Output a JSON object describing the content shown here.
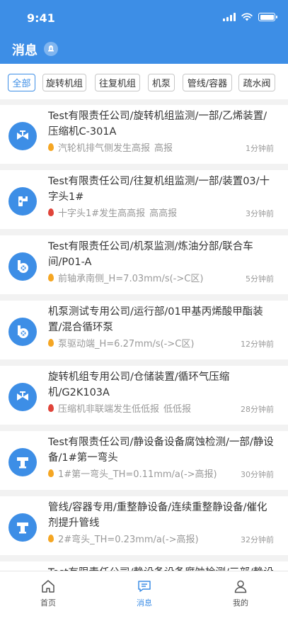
{
  "status": {
    "time": "9:41"
  },
  "header": {
    "title": "消息"
  },
  "filters": [
    "全部",
    "旋转机组",
    "往复机组",
    "机泵",
    "管线/容器",
    "疏水阀"
  ],
  "messages": [
    {
      "icon": "valve-icon",
      "title": "Test有限责任公司/旋转机组监测/一部/乙烯装置/压缩机C-301A",
      "detail": "汽轮机排气侧发生高报",
      "level": "高报",
      "time": "1分钟前",
      "drop": "#f5a623"
    },
    {
      "icon": "faucet-icon",
      "title": "Test有限责任公司/往复机组监测/一部/装置03/十字头1#",
      "detail": "十字头1#发生高高报",
      "level": "高高报",
      "time": "3分钟前",
      "drop": "#e0443a"
    },
    {
      "icon": "pump-icon",
      "title": "Test有限责任公司/机泵监测/炼油分部/联合车间/P01-A",
      "detail": "前轴承南侧_H=7.03mm/s(->C区)",
      "level": "",
      "time": "5分钟前",
      "drop": "#f5a623"
    },
    {
      "icon": "pump-icon",
      "title": "机泵测试专用公司/运行部/01甲基丙烯酸甲酯装置/混合循环泵",
      "detail": "泵驱动端_H=6.27mm/s(->C区)",
      "level": "",
      "time": "12分钟前",
      "drop": "#f5a623"
    },
    {
      "icon": "valve-icon",
      "title": "旋转机组专用公司/仓储装置/循环气压缩机/G2K103A",
      "detail": "压缩机非联端发生低低报",
      "level": "低低报",
      "time": "28分钟前",
      "drop": "#e0443a"
    },
    {
      "icon": "pipe-icon",
      "title": "Test有限责任公司/静设备设备腐蚀检测/一部/静设备/1#第一弯头",
      "detail": "1#第一弯头_TH=0.11mm/a(->高报)",
      "level": "",
      "time": "30分钟前",
      "drop": "#f5a623"
    },
    {
      "icon": "pipe-icon",
      "title": "管线/容器专用/重整静设备/连续重整静设备/催化剂提升管线",
      "detail": "2#弯头_TH=0.23mm/a(->高报)",
      "level": "",
      "time": "32分钟前",
      "drop": "#f5a623"
    },
    {
      "icon": "pipe-icon",
      "title": "Test有限责任公司/静设备设备腐蚀检测/三部/静设",
      "detail": "",
      "level": "",
      "time": "",
      "drop": "#f5a623"
    }
  ],
  "tabs": [
    {
      "label": "首页",
      "icon": "home-icon"
    },
    {
      "label": "消息",
      "icon": "message-icon"
    },
    {
      "label": "我的",
      "icon": "user-icon"
    }
  ],
  "colors": {
    "primary": "#3d8ee6",
    "warning": "#f5a623",
    "danger": "#e0443a"
  }
}
